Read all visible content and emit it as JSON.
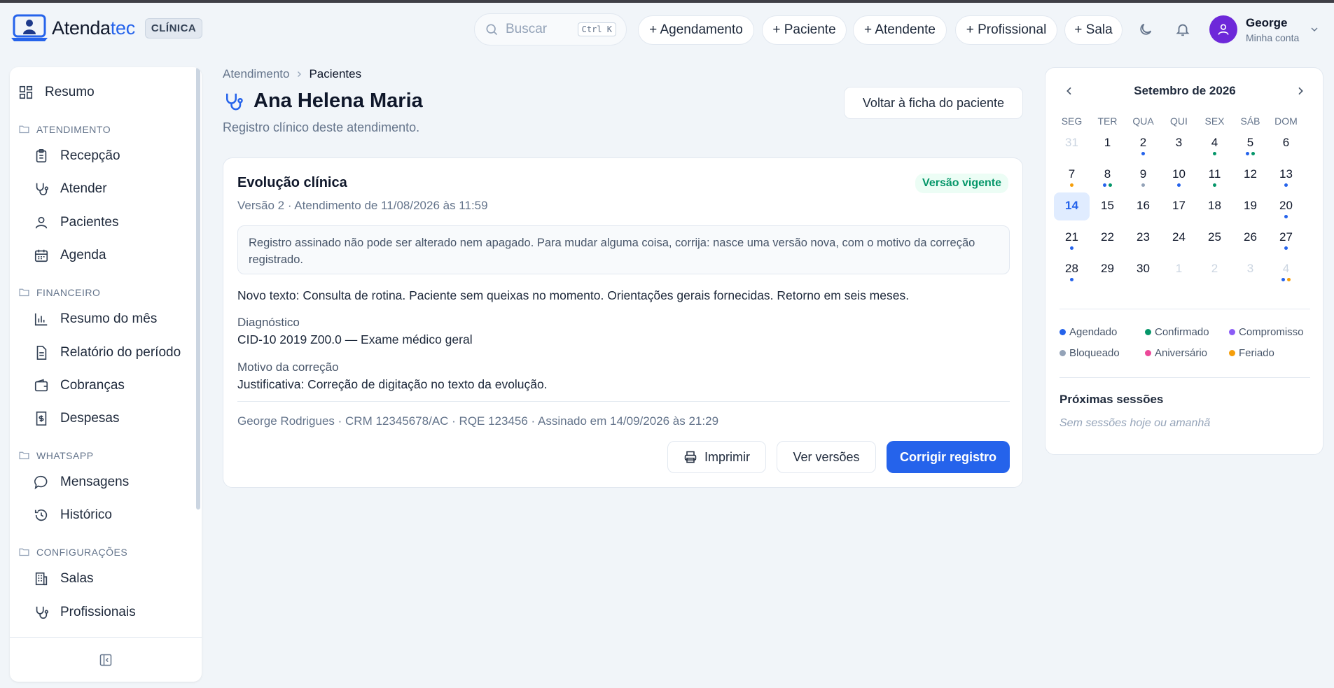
{
  "app": {
    "name_main": "Atenda",
    "name_accent": "tec",
    "badge": "CLÍNICA"
  },
  "header": {
    "search_placeholder": "Buscar",
    "search_shortcut": "Ctrl K",
    "quick_actions": [
      "+ Agendamento",
      "+ Paciente",
      "+ Atendente",
      "+ Profissional",
      "+ Sala"
    ],
    "user_name": "George",
    "user_subtitle": "Minha conta"
  },
  "sidebar": {
    "top_item": "Resumo",
    "sections": [
      {
        "title": "ATENDIMENTO",
        "items": [
          "Recepção",
          "Atender",
          "Pacientes",
          "Agenda"
        ]
      },
      {
        "title": "FINANCEIRO",
        "items": [
          "Resumo do mês",
          "Relatório do período",
          "Cobranças",
          "Despesas"
        ]
      },
      {
        "title": "WHATSAPP",
        "items": [
          "Mensagens",
          "Histórico"
        ]
      },
      {
        "title": "CONFIGURAÇÕES",
        "items": [
          "Salas",
          "Profissionais"
        ]
      }
    ]
  },
  "page": {
    "breadcrumb": [
      "Atendimento",
      "Pacientes"
    ],
    "title": "Ana Helena Maria",
    "subtitle": "Registro clínico deste atendimento.",
    "back_button": "Voltar à ficha do paciente"
  },
  "record": {
    "title": "Evolução clínica",
    "status": "Versão vigente",
    "meta": "Versão 2 · Atendimento de 11/08/2026 às 11:59",
    "notice": "Registro assinado não pode ser alterado nem apagado. Para mudar alguma coisa, corrija: nasce uma versão nova, com o motivo da correção registrado.",
    "text": "Novo texto: Consulta de rotina. Paciente sem queixas no momento. Orientações gerais fornecidas. Retorno em seis meses.",
    "diagnosis_label": "Diagnóstico",
    "diagnosis_value": "CID-10 2019 Z00.0 — Exame médico geral",
    "reason_label": "Motivo da correção",
    "reason_value": "Justificativa: Correção de digitação no texto da evolução.",
    "signature": "George Rodrigues · CRM 12345678/AC · RQE 123456 · Assinado em 14/09/2026 às 21:29",
    "actions": {
      "print": "Imprimir",
      "versions": "Ver versões",
      "correct": "Corrigir registro"
    }
  },
  "calendar": {
    "month": "Setembro de 2026",
    "weekdays": [
      "SEG",
      "TER",
      "QUA",
      "QUI",
      "SEX",
      "SÁB",
      "DOM"
    ],
    "colors": {
      "agendado": "#2563eb",
      "confirmado": "#059669",
      "compromisso": "#8b5cf6",
      "bloqueado": "#94a3b8",
      "aniversario": "#ec4899",
      "feriado": "#f59e0b"
    },
    "today": "14",
    "weeks": [
      [
        {
          "d": "31",
          "m": true
        },
        {
          "d": "1"
        },
        {
          "d": "2",
          "dots": [
            "agendado"
          ]
        },
        {
          "d": "3"
        },
        {
          "d": "4",
          "dots": [
            "confirmado"
          ]
        },
        {
          "d": "5",
          "dots": [
            "agendado",
            "confirmado"
          ]
        },
        {
          "d": "6"
        }
      ],
      [
        {
          "d": "7",
          "dots": [
            "feriado"
          ]
        },
        {
          "d": "8",
          "dots": [
            "agendado",
            "confirmado"
          ]
        },
        {
          "d": "9",
          "dots": [
            "bloqueado"
          ]
        },
        {
          "d": "10",
          "dots": [
            "agendado"
          ]
        },
        {
          "d": "11",
          "dots": [
            "confirmado"
          ]
        },
        {
          "d": "12"
        },
        {
          "d": "13",
          "dots": [
            "agendado"
          ]
        }
      ],
      [
        {
          "d": "14"
        },
        {
          "d": "15"
        },
        {
          "d": "16"
        },
        {
          "d": "17"
        },
        {
          "d": "18"
        },
        {
          "d": "19"
        },
        {
          "d": "20",
          "dots": [
            "agendado"
          ]
        }
      ],
      [
        {
          "d": "21",
          "dots": [
            "agendado"
          ]
        },
        {
          "d": "22"
        },
        {
          "d": "23"
        },
        {
          "d": "24"
        },
        {
          "d": "25"
        },
        {
          "d": "26"
        },
        {
          "d": "27",
          "dots": [
            "agendado"
          ]
        }
      ],
      [
        {
          "d": "28",
          "dots": [
            "agendado"
          ]
        },
        {
          "d": "29"
        },
        {
          "d": "30"
        },
        {
          "d": "1",
          "m": true
        },
        {
          "d": "2",
          "m": true
        },
        {
          "d": "3",
          "m": true
        },
        {
          "d": "4",
          "m": true,
          "dots": [
            "agendado",
            "feriado"
          ]
        }
      ]
    ],
    "legend": [
      {
        "label": "Agendado",
        "key": "agendado"
      },
      {
        "label": "Confirmado",
        "key": "confirmado"
      },
      {
        "label": "Compromisso",
        "key": "compromisso"
      },
      {
        "label": "Bloqueado",
        "key": "bloqueado"
      },
      {
        "label": "Aniversário",
        "key": "aniversario"
      },
      {
        "label": "Feriado",
        "key": "feriado"
      }
    ],
    "next_sessions_title": "Próximas sessões",
    "next_sessions_empty": "Sem sessões hoje ou amanhã"
  }
}
